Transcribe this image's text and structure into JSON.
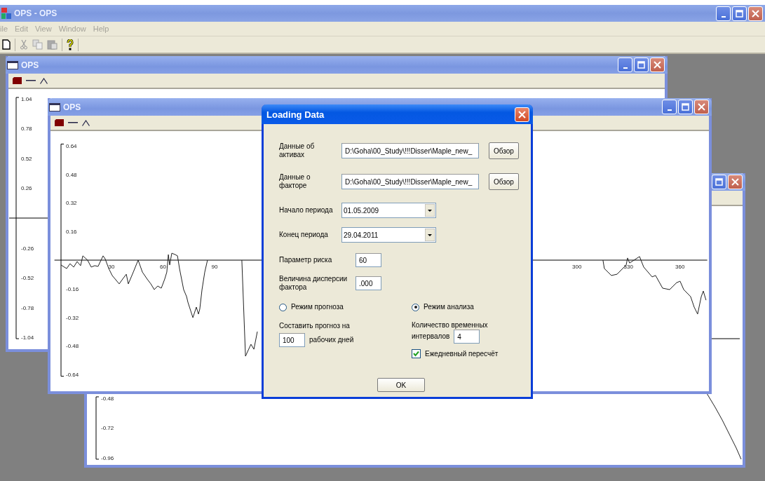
{
  "app": {
    "title": "OPS - OPS",
    "menu": [
      {
        "label": "ile",
        "disabled": true
      },
      {
        "label": "Edit",
        "disabled": true
      },
      {
        "label": "View",
        "disabled": true
      },
      {
        "label": "Window",
        "disabled": true
      },
      {
        "label": "Help",
        "disabled": true
      }
    ]
  },
  "windows": [
    {
      "title": "OPS",
      "y_ticks": [
        "1.04",
        "0.78",
        "0.52",
        "0.26",
        "-0.26",
        "-0.52",
        "-0.78",
        "-1.04"
      ]
    },
    {
      "y_ticks": [
        "-0.48",
        "-0.72",
        "-0.96"
      ]
    },
    {
      "title": "OPS",
      "chart_data": {
        "type": "line",
        "x": [
          0.8,
          4.1,
          6.1,
          8.2,
          10.2,
          12.2,
          13.5,
          16.3,
          18.4,
          20.4,
          22.4,
          23.7,
          25.3,
          26.5,
          28.6,
          30.6,
          32.7,
          34.7,
          36.7,
          38.8,
          40,
          42.9,
          45.7,
          48.2,
          51,
          53.1,
          55.1,
          57.1,
          59.2,
          61.2,
          62.4,
          63.3,
          64.1,
          65.3,
          67.3,
          68.6,
          69.8,
          72.2,
          73.9,
          74.7,
          76.3,
          77.6,
          79.6,
          80.8,
          81.6,
          82.9,
          84.5,
          86.1,
          96,
          106.1,
          108.2,
          111.4,
          113.1,
          115.1,
          200,
          316.3,
          317.1,
          321.2,
          324.5,
          329.8,
          330.6,
          331.8,
          337.6,
          340,
          344.9,
          346.9,
          351,
          355.1,
          359.2,
          361.2,
          363.3,
          367.3,
          369.4,
          371.4,
          373.5,
          374.7,
          376.3
        ],
        "series": [
          {
            "color": "#222222",
            "values": [
              -0.027,
              -0.047,
              -0.02,
              -0.039,
              -0.008,
              -0.031,
              0.024,
              0,
              -0.039,
              -0.031,
              -0.035,
              -0.008,
              0.024,
              0.008,
              -0.047,
              -0.086,
              -0.11,
              -0.133,
              -0.106,
              -0.079,
              -0.133,
              -0.067,
              0,
              -0.067,
              -0.106,
              -0.133,
              -0.165,
              -0.145,
              -0.157,
              -0.106,
              -0.067,
              0.031,
              -0.027,
              0.039,
              0.031,
              0.024,
              -0.047,
              -0.165,
              -0.204,
              -0.236,
              -0.283,
              -0.322,
              -0.263,
              -0.302,
              -0.275,
              -0.165,
              -0.067,
              0,
              null,
              0,
              -0.538,
              -0.471,
              -0.499,
              -0.4,
              null,
              0,
              -0.047,
              -0.086,
              -0.079,
              -0.027,
              0.012,
              -0.016,
              0.02,
              -0.039,
              -0.094,
              -0.086,
              -0.157,
              -0.165,
              -0.126,
              -0.118,
              -0.165,
              -0.204,
              -0.263,
              -0.302,
              -0.204,
              -0.173,
              -0.224
            ]
          }
        ],
        "xlim": [
          -3,
          377
        ],
        "ylim": [
          -0.65,
          0.65
        ],
        "xticks": [
          30,
          60,
          90,
          300,
          330,
          360
        ],
        "yticks": [
          0.64,
          0.48,
          0.32,
          0.16,
          -0.16,
          -0.32,
          -0.48,
          -0.64
        ]
      }
    }
  ],
  "dialog": {
    "title": "Loading Data",
    "file_rows": [
      {
        "label": "Данные об активах",
        "value": "D:\\Goha\\00_Study\\!!!Disser\\Maple_new_",
        "button": "Обзор"
      },
      {
        "label": "Данные о факторе",
        "value": "D:\\Goha\\00_Study\\!!!Disser\\Maple_new_",
        "button": "Обзор"
      }
    ],
    "date_rows": [
      {
        "label": "Начало периода",
        "value": "01.05.2009"
      },
      {
        "label": "Конец периода",
        "value": "29.04.2011"
      }
    ],
    "param_rows": [
      {
        "label": "Параметр риска",
        "value": "60"
      },
      {
        "label": "Величина дисперсии фактора",
        "value": ".000"
      }
    ],
    "modes": [
      {
        "label": "Режим прогноза",
        "selected": false
      },
      {
        "label": "Режим анализа",
        "selected": true
      }
    ],
    "forecast": {
      "label": "Составить прогноз на",
      "value": "100",
      "unit": "рабочих дней"
    },
    "intervals": {
      "label": "Количество временных",
      "label_2": "интервалов",
      "value": "4"
    },
    "daily": {
      "label": "Ежедневный пересчёт",
      "checked": true
    },
    "ok": "OK"
  }
}
